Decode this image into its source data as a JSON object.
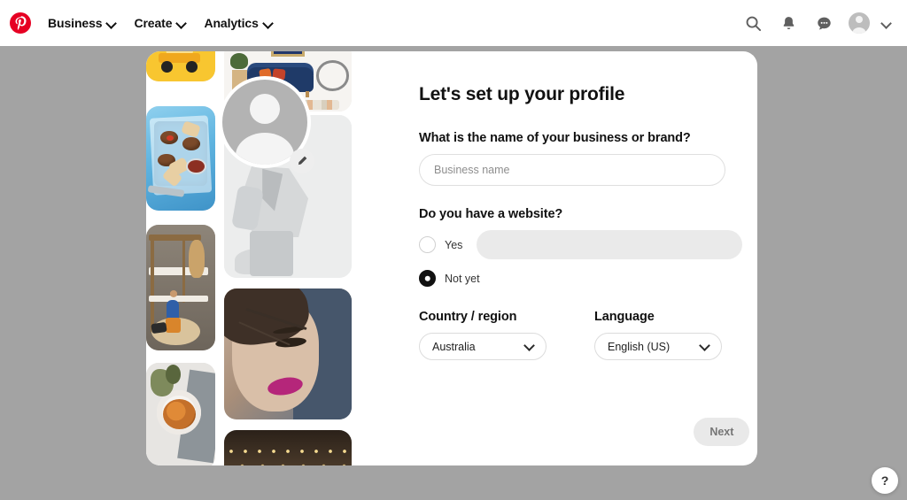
{
  "header": {
    "logo": "pinterest-logo",
    "nav_items": [
      {
        "label": "Business",
        "icon": "chevron-down-icon"
      },
      {
        "label": "Create",
        "icon": "chevron-down-icon"
      },
      {
        "label": "Analytics",
        "icon": "chevron-down-icon"
      }
    ],
    "actions": [
      {
        "name": "search-icon"
      },
      {
        "name": "notifications-bell-icon"
      },
      {
        "name": "messages-icon"
      },
      {
        "name": "account-avatar"
      },
      {
        "name": "chevron-down-icon"
      }
    ]
  },
  "setup": {
    "title": "Let's set up your profile",
    "business_question": "What is the name of your business or brand?",
    "business_placeholder": "Business name",
    "business_value": "",
    "website_question": "Do you have a website?",
    "website_options": [
      {
        "label": "Yes",
        "selected": false
      },
      {
        "label": "Not yet",
        "selected": true
      }
    ],
    "website_placeholder": "",
    "website_value": "",
    "country_label": "Country / region",
    "country_value": "Australia",
    "language_label": "Language",
    "language_value": "English (US)",
    "next_label": "Next",
    "next_disabled": true
  },
  "collage": {
    "avatar_alt": "profile-avatar-placeholder",
    "edit_icon": "pencil-edit-icon",
    "tiles": [
      "toy-truck-yellow",
      "food-plate-blue",
      "kids-bunk-bed-room",
      "noodle-bowl-overhead",
      "living-room-blue-sofa",
      "man-in-grey-jacket",
      "woman-portrait-pink-lips",
      "string-lights-night"
    ]
  },
  "help": {
    "label": "?"
  },
  "colors": {
    "brand_red": "#e60023",
    "page_background": "#a3a3a3",
    "card_background": "#ffffff",
    "disabled_button": "#e9e9e9"
  }
}
